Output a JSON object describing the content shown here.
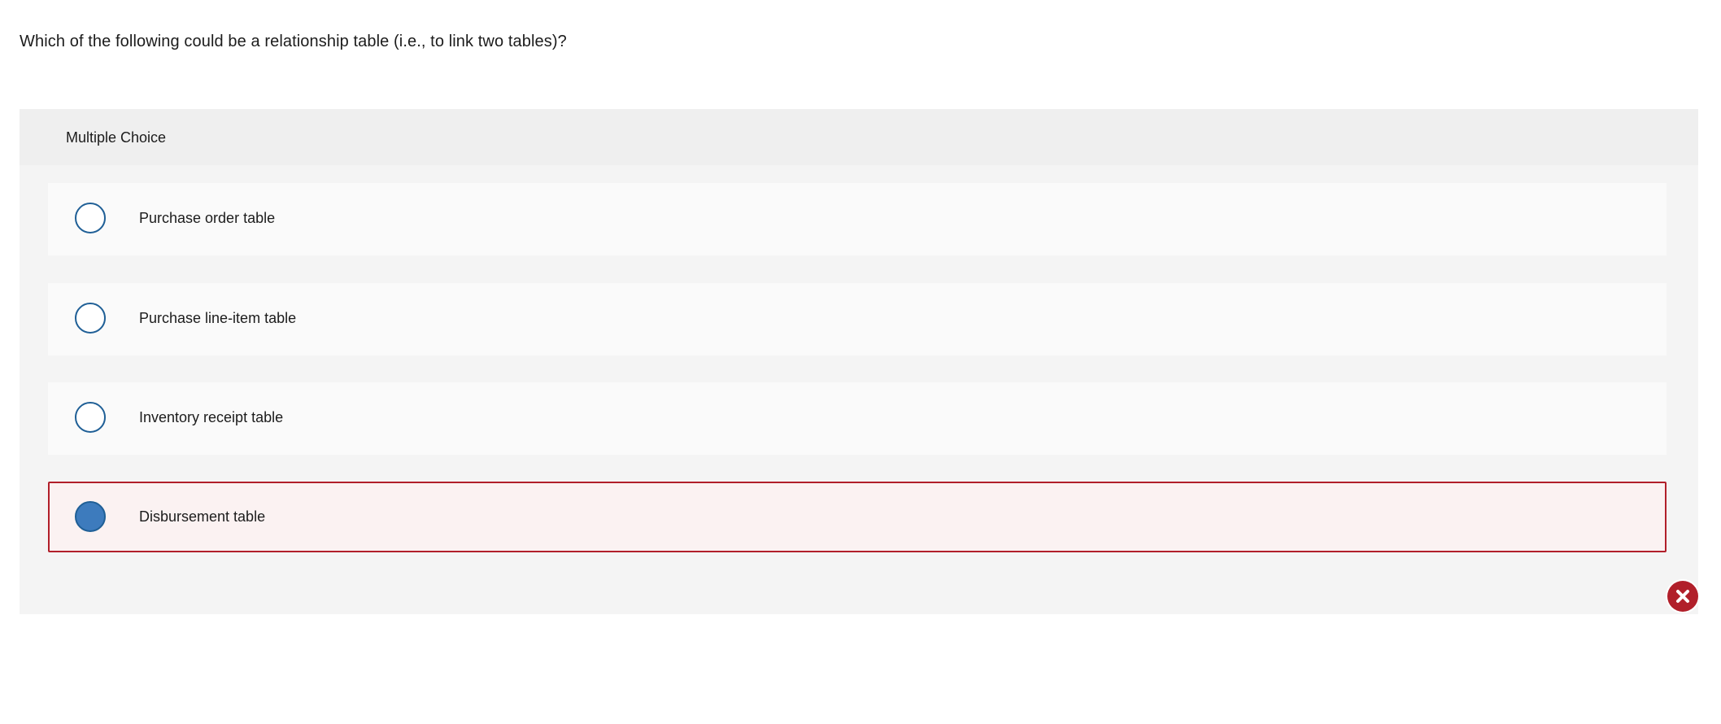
{
  "question": {
    "text": "Which of the following could be a relationship table (i.e., to link two tables)?"
  },
  "panel": {
    "title": "Multiple Choice"
  },
  "options": [
    {
      "label": "Purchase order table",
      "selected": false,
      "status": ""
    },
    {
      "label": "Purchase line-item table",
      "selected": false,
      "status": ""
    },
    {
      "label": "Inventory receipt table",
      "selected": false,
      "status": ""
    },
    {
      "label": "Disbursement table",
      "selected": true,
      "status": "incorrect"
    }
  ],
  "colors": {
    "accent": "#1f5f96",
    "selected_fill": "#3d7bbd",
    "incorrect": "#b11f2a"
  },
  "icons": {
    "incorrect_marker": "close-icon"
  }
}
